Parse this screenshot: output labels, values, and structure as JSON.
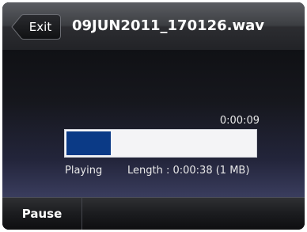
{
  "header": {
    "exit_label": "Exit",
    "title": "09JUN2011_170126.wav"
  },
  "player": {
    "elapsed": "0:00:09",
    "progress_fraction": 0.2368,
    "status": "Playing",
    "length_text": "Length :  0:00:38 (1 MB)"
  },
  "softkeys": {
    "key1": "Pause"
  },
  "colors": {
    "progress_fill": "#0b3a86",
    "progress_track": "#f4f4f6"
  }
}
